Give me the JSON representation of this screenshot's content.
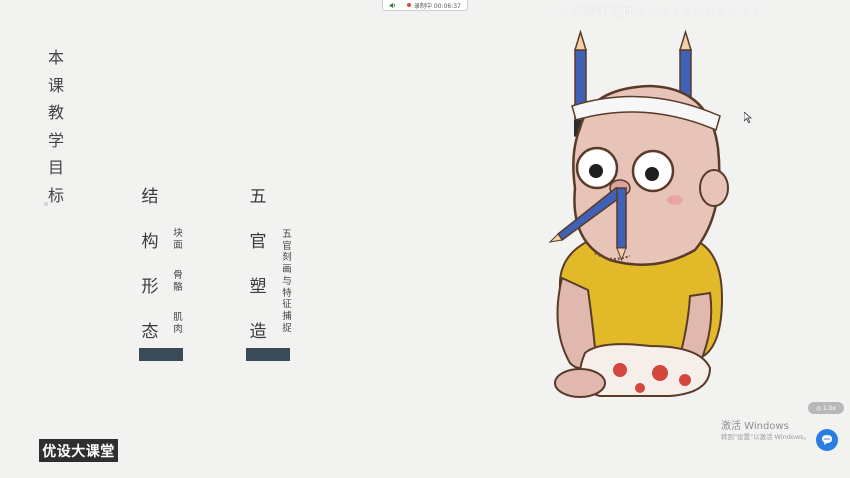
{
  "recording_bar": {
    "status": "录制中 00:06:37"
  },
  "watermark": "一 学霸课 程群 0 1 4 1 5 0 4 4 1 1 9",
  "vertical_title": [
    "本",
    "课",
    "教",
    "学",
    "目",
    "标"
  ],
  "sections": [
    {
      "big_chars": [
        "结",
        "构",
        "形",
        "态"
      ],
      "sub_items": [
        "块面",
        "骨骼",
        "肌肉"
      ]
    },
    {
      "big_chars": [
        "五",
        "官",
        "塑",
        "造"
      ],
      "sub_text": "五官刻画与特征捕捉"
    }
  ],
  "logo_text": "优设大课堂",
  "windows_activation": {
    "line1": "激活 Windows",
    "line2": "转到\"设置\"以激活 Windows。"
  },
  "pill_label": "◎ 1.0x",
  "icons": {
    "speaker": "speaker-icon",
    "chat": "chat-bubble-icon",
    "cursor": "mouse-cursor-icon"
  },
  "colors": {
    "background": "#f2f2f0",
    "section_bar": "#3a4a56",
    "logo_bg": "#2f2f30",
    "chat_button": "#2a7de1",
    "shirt": "#e2b928",
    "pencil": "#3f62b8"
  }
}
